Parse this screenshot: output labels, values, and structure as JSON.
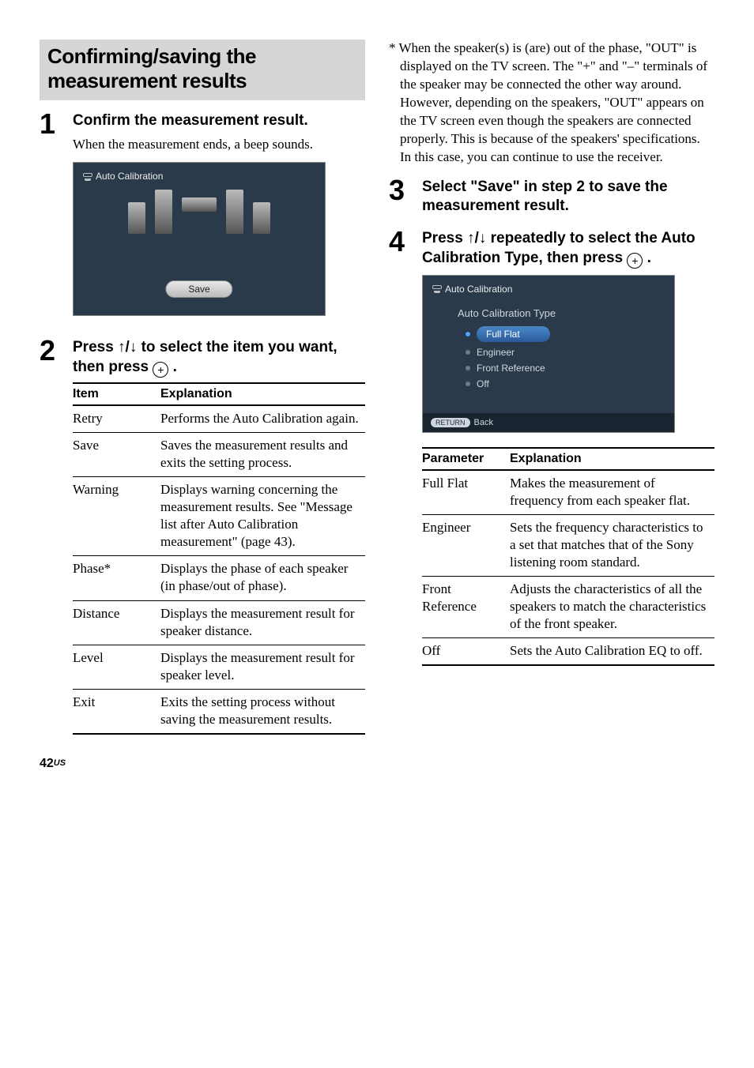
{
  "sectionTitle": "Confirming/saving the measurement results",
  "steps": {
    "s1": {
      "num": "1",
      "heading": "Confirm the measurement result.",
      "desc": "When the measurement ends, a beep sounds."
    },
    "s2": {
      "num": "2",
      "heading": "Press ↑/↓ to select the item you want, then press "
    },
    "s3": {
      "num": "3",
      "heading": "Select \"Save\" in step 2 to save the measurement result."
    },
    "s4": {
      "num": "4",
      "heading": "Press ↑/↓ repeatedly to select the Auto Calibration Type, then press "
    }
  },
  "footnote": "* When the speaker(s) is (are) out of the phase, \"OUT\" is displayed on the TV screen. The \"+\" and \"–\" terminals of the speaker may be connected the other way around. However, depending on the speakers, \"OUT\" appears on the TV screen even though the speakers are connected properly. This is because of the speakers' specifications. In this case, you can continue to use the receiver.",
  "ss1": {
    "title": "Auto Calibration",
    "save": "Save"
  },
  "ss2": {
    "title": "Auto Calibration",
    "sub": "Auto Calibration Type",
    "opts": [
      "Full Flat",
      "Engineer",
      "Front Reference",
      "Off"
    ],
    "return": "RETURN",
    "back": "Back"
  },
  "table1": {
    "headers": [
      "Item",
      "Explanation"
    ],
    "rows": [
      [
        "Retry",
        "Performs the Auto Calibration again."
      ],
      [
        "Save",
        "Saves the measurement results and exits the setting process."
      ],
      [
        "Warning",
        "Displays warning concerning the measurement results. See \"Message list after Auto Calibration measurement\" (page 43)."
      ],
      [
        "Phase*",
        "Displays the phase of each speaker (in phase/out of phase)."
      ],
      [
        "Distance",
        "Displays the measurement result for speaker distance."
      ],
      [
        "Level",
        "Displays the measurement result for speaker level."
      ],
      [
        "Exit",
        "Exits the setting process without saving the measurement results."
      ]
    ]
  },
  "table2": {
    "headers": [
      "Parameter",
      "Explanation"
    ],
    "rows": [
      [
        "Full Flat",
        "Makes the measurement of frequency from each speaker flat."
      ],
      [
        "Engineer",
        "Sets the frequency characteristics to a set that matches that of the Sony listening room standard."
      ],
      [
        "Front Reference",
        "Adjusts the characteristics of all the speakers to match the characteristics of the front speaker."
      ],
      [
        "Off",
        "Sets the Auto Calibration EQ to off."
      ]
    ]
  },
  "pageNum": "42",
  "pageRegion": "US"
}
